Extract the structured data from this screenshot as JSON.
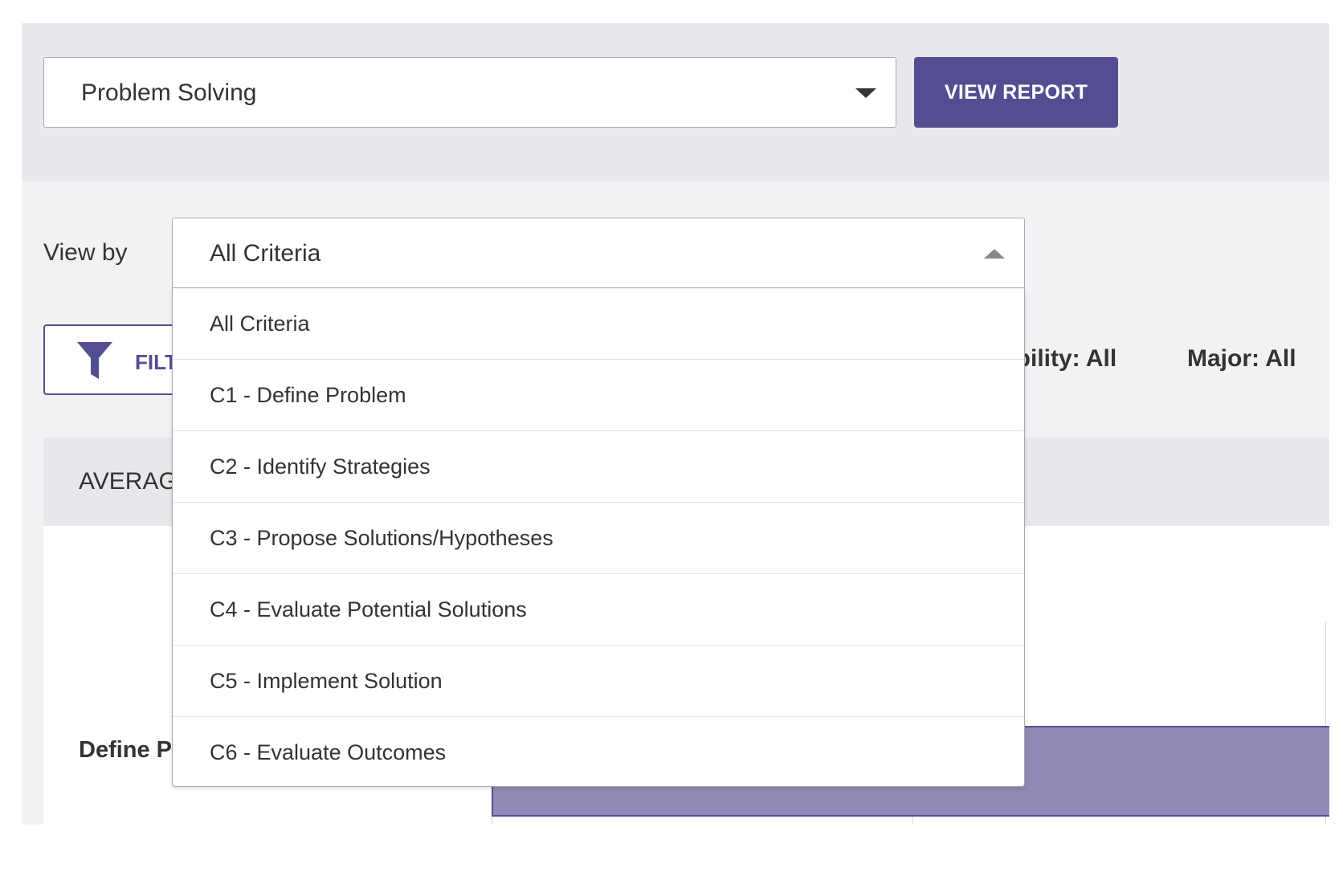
{
  "header": {
    "skill_select_value": "Problem Solving",
    "view_report_label": "VIEW REPORT"
  },
  "controls": {
    "view_by_label": "View by",
    "view_by_value": "All Criteria",
    "filter_label": "FILT"
  },
  "filter_summary": {
    "eligibility": "gibility: All",
    "major": "Major: All"
  },
  "section": {
    "title": "AVERAG"
  },
  "chart": {
    "row_label": "Define P"
  },
  "dropdown": {
    "options": [
      "All Criteria",
      "C1 - Define Problem",
      "C2 - Identify Strategies",
      "C3 - Propose Solutions/Hypotheses",
      "C4 - Evaluate Potential Solutions",
      "C5 - Implement Solution",
      "C6 - Evaluate Outcomes"
    ]
  },
  "colors": {
    "accent": "#534e92",
    "bar_fill": "#9189b4",
    "band_bg": "#e9e8ec"
  },
  "icons": {
    "skill_select": "chevron-down-icon",
    "view_by_select": "chevron-up-icon",
    "filter": "filter-icon"
  }
}
